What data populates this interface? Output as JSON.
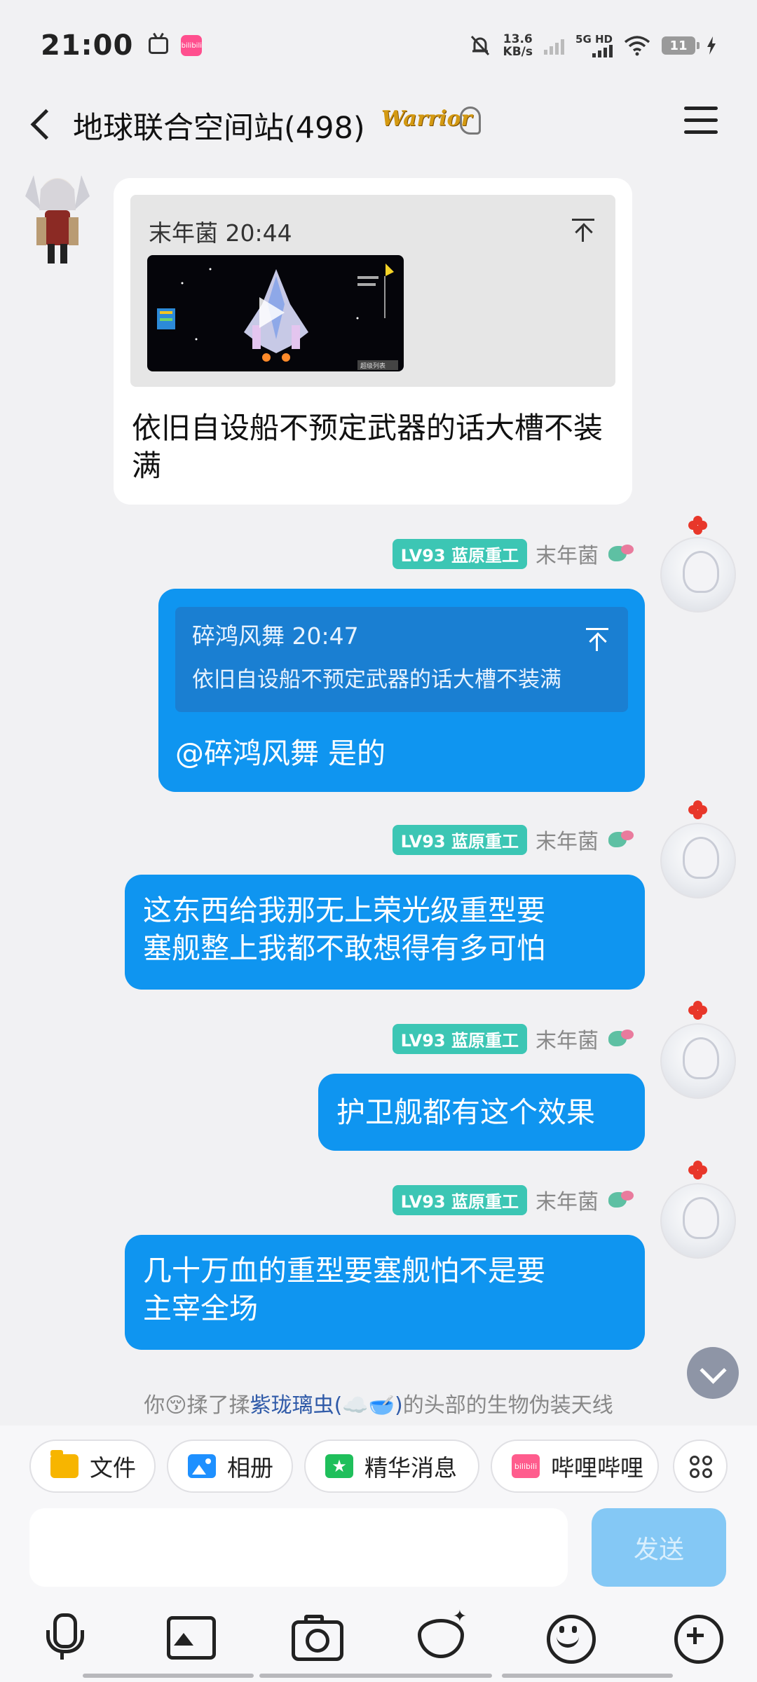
{
  "status_bar": {
    "time": "21:00",
    "app_icon_bili": "bilibili",
    "net_speed_value": "13.6",
    "net_speed_unit": "KB/s",
    "network_type": "5G HD",
    "battery_level": "11"
  },
  "header": {
    "title": "地球联合空间站(498)",
    "badge_text": "Warrior"
  },
  "messages": {
    "m1": {
      "quote_author_time": "末年菌 20:44",
      "video_label": "超级列表",
      "text": "依旧自设船不预定武器的话大槽不装满"
    },
    "m2": {
      "level_badge": "LV93 蓝原重工",
      "sender": "末年菌",
      "quote_author_time": "碎鸿风舞 20:47",
      "quote_text": "依旧自设船不预定武器的话大槽不装满",
      "text": "@碎鸿风舞 是的"
    },
    "m3": {
      "level_badge": "LV93 蓝原重工",
      "sender": "末年菌",
      "text_line1": "这东西给我那无上荣光级重型要",
      "text_line2": "塞舰整上我都不敢想得有多可怕"
    },
    "m4": {
      "level_badge": "LV93 蓝原重工",
      "sender": "末年菌",
      "text": "护卫舰都有这个效果"
    },
    "m5": {
      "level_badge": "LV93 蓝原重工",
      "sender": "末年菌",
      "text_line1": "几十万血的重型要塞舰怕不是要",
      "text_line2": "主宰全场"
    }
  },
  "notice": {
    "prefix": "你",
    "emoji": "😚",
    "middle": "揉了揉",
    "target": "紫珑璃虫",
    "target_emojis": "(☁️🥣)",
    "suffix": "的头部的生物伪装天线"
  },
  "quick_actions": [
    {
      "label": "文件",
      "icon": "folder-icon"
    },
    {
      "label": "相册",
      "icon": "album-icon"
    },
    {
      "label": "精华消息",
      "icon": "star-icon"
    },
    {
      "label": "哔哩哔哩",
      "icon": "bilibili-icon",
      "icon_text": "bilibili"
    }
  ],
  "input": {
    "placeholder": "",
    "send_label": "发送"
  },
  "colors": {
    "bubble_blue": "#0f95f0",
    "level_badge": "#3cc6b4",
    "send_disabled": "#84c8f5"
  }
}
